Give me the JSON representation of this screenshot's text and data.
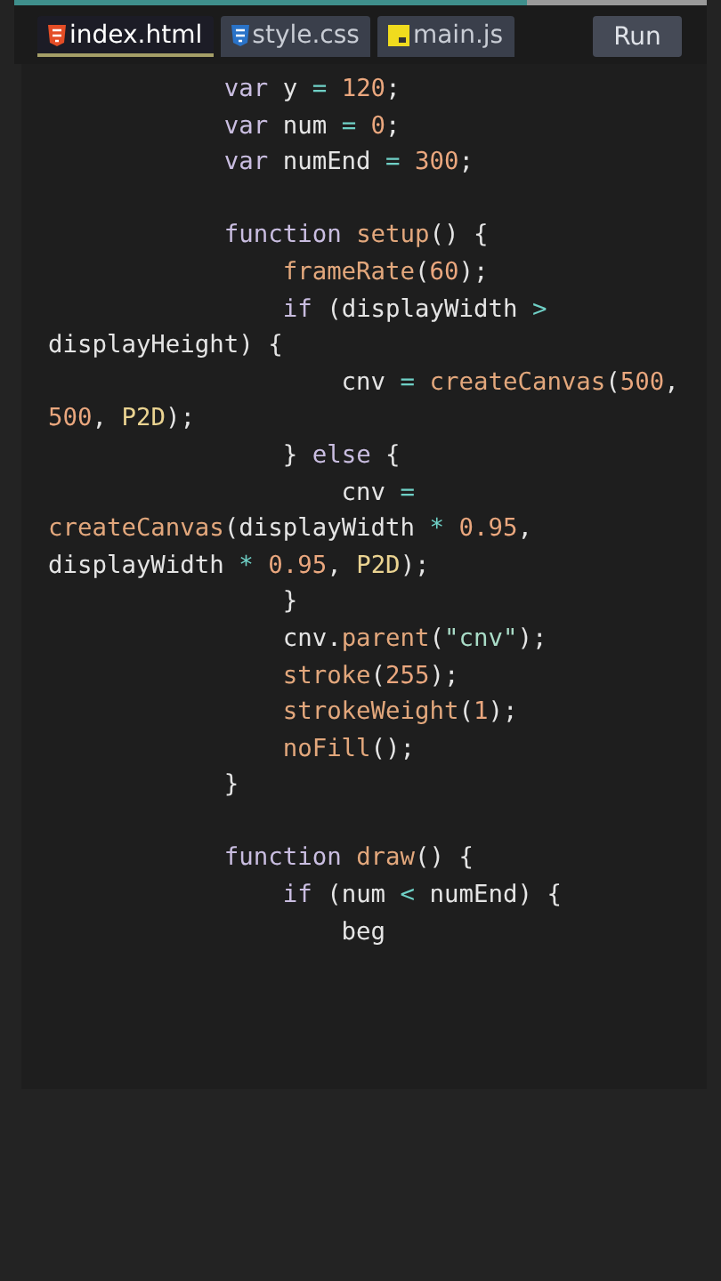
{
  "progress": {
    "level": 0.74
  },
  "tabs": [
    {
      "label": "index.html",
      "kind": "html",
      "selected": true
    },
    {
      "label": "style.css",
      "kind": "css",
      "selected": false
    },
    {
      "label": "main.js",
      "kind": "js",
      "selected": false
    }
  ],
  "run_button": {
    "label": "Run"
  },
  "code_lines": [
    {
      "tokens": [
        {
          "text": "            var",
          "kind": "keyword"
        },
        {
          "text": " y ",
          "kind": "plain"
        },
        {
          "text": "= ",
          "kind": "operator"
        },
        {
          "text": "120",
          "kind": "number"
        },
        {
          "text": ";",
          "kind": "plain"
        }
      ]
    },
    {
      "tokens": [
        {
          "text": "            var",
          "kind": "keyword"
        },
        {
          "text": " num ",
          "kind": "plain"
        },
        {
          "text": "= ",
          "kind": "operator"
        },
        {
          "text": "0",
          "kind": "number"
        },
        {
          "text": ";",
          "kind": "plain"
        }
      ]
    },
    {
      "tokens": [
        {
          "text": "            var",
          "kind": "keyword"
        },
        {
          "text": " numEnd ",
          "kind": "plain"
        },
        {
          "text": "= ",
          "kind": "operator"
        },
        {
          "text": "300",
          "kind": "number"
        },
        {
          "text": ";",
          "kind": "plain"
        }
      ]
    },
    {
      "blank_before": true,
      "tokens": [
        {
          "text": "            function ",
          "kind": "keyword"
        },
        {
          "text": "setup",
          "kind": "function"
        },
        {
          "text": "() {",
          "kind": "plain"
        }
      ]
    },
    {
      "tokens": [
        {
          "text": "                frameRate",
          "kind": "function"
        },
        {
          "text": "(",
          "kind": "plain"
        },
        {
          "text": "60",
          "kind": "number"
        },
        {
          "text": ");",
          "kind": "plain"
        }
      ]
    },
    {
      "tokens": [
        {
          "text": "                if",
          "kind": "keyword"
        },
        {
          "text": " (displayWidth ",
          "kind": "plain"
        },
        {
          "text": ">",
          "kind": "operator"
        }
      ]
    },
    {
      "tokens": [
        {
          "text": "displayHeight) {",
          "kind": "plain"
        }
      ]
    },
    {
      "tokens": [
        {
          "text": "                    cnv ",
          "kind": "plain"
        },
        {
          "text": "= ",
          "kind": "operator"
        },
        {
          "text": "createCanvas",
          "kind": "function"
        },
        {
          "text": "(",
          "kind": "plain"
        },
        {
          "text": "500",
          "kind": "number"
        },
        {
          "text": ",",
          "kind": "plain"
        }
      ]
    },
    {
      "tokens": [
        {
          "text": "500",
          "kind": "number"
        },
        {
          "text": ", ",
          "kind": "plain"
        },
        {
          "text": "P2D",
          "kind": "constant"
        },
        {
          "text": ");",
          "kind": "plain"
        }
      ]
    },
    {
      "tokens": [
        {
          "text": "                } ",
          "kind": "plain"
        },
        {
          "text": "else",
          "kind": "keyword"
        },
        {
          "text": " {",
          "kind": "plain"
        }
      ]
    },
    {
      "tokens": [
        {
          "text": "                    cnv ",
          "kind": "plain"
        },
        {
          "text": "=",
          "kind": "operator"
        }
      ]
    },
    {
      "tokens": [
        {
          "text": "createCanvas",
          "kind": "function"
        },
        {
          "text": "(displayWidth ",
          "kind": "plain"
        },
        {
          "text": "* ",
          "kind": "operator"
        },
        {
          "text": "0.95",
          "kind": "number"
        },
        {
          "text": ",",
          "kind": "plain"
        }
      ]
    },
    {
      "tokens": [
        {
          "text": "displayWidth ",
          "kind": "plain"
        },
        {
          "text": "* ",
          "kind": "operator"
        },
        {
          "text": "0.95",
          "kind": "number"
        },
        {
          "text": ", ",
          "kind": "plain"
        },
        {
          "text": "P2D",
          "kind": "constant"
        },
        {
          "text": ");",
          "kind": "plain"
        }
      ]
    },
    {
      "tokens": [
        {
          "text": "                }",
          "kind": "plain"
        }
      ]
    },
    {
      "tokens": [
        {
          "text": "                cnv.",
          "kind": "plain"
        },
        {
          "text": "parent",
          "kind": "function"
        },
        {
          "text": "(",
          "kind": "plain"
        },
        {
          "text": "\"cnv\"",
          "kind": "string"
        },
        {
          "text": ");",
          "kind": "plain"
        }
      ]
    },
    {
      "tokens": [
        {
          "text": "                stroke",
          "kind": "function"
        },
        {
          "text": "(",
          "kind": "plain"
        },
        {
          "text": "255",
          "kind": "number"
        },
        {
          "text": ");",
          "kind": "plain"
        }
      ]
    },
    {
      "tokens": [
        {
          "text": "                strokeWeight",
          "kind": "function"
        },
        {
          "text": "(",
          "kind": "plain"
        },
        {
          "text": "1",
          "kind": "number"
        },
        {
          "text": ");",
          "kind": "plain"
        }
      ]
    },
    {
      "tokens": [
        {
          "text": "                noFill",
          "kind": "function"
        },
        {
          "text": "();",
          "kind": "plain"
        }
      ]
    },
    {
      "tokens": [
        {
          "text": "            }",
          "kind": "plain"
        }
      ]
    },
    {
      "blank_before": true,
      "tokens": [
        {
          "text": "            function ",
          "kind": "keyword"
        },
        {
          "text": "draw",
          "kind": "function"
        },
        {
          "text": "() {",
          "kind": "plain"
        }
      ]
    },
    {
      "tokens": [
        {
          "text": "                if",
          "kind": "keyword"
        },
        {
          "text": " (num ",
          "kind": "plain"
        },
        {
          "text": "< ",
          "kind": "operator"
        },
        {
          "text": "numEnd) {",
          "kind": "plain"
        }
      ]
    },
    {
      "tokens": [
        {
          "text": "                    beg",
          "kind": "plain"
        }
      ]
    }
  ]
}
